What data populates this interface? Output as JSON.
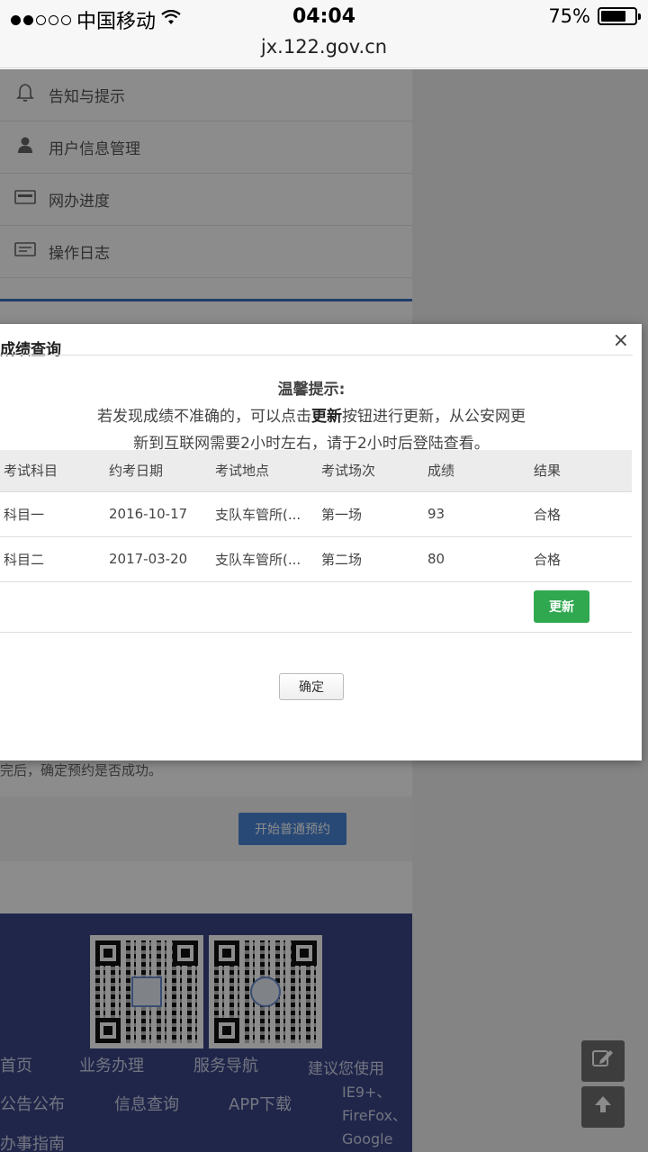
{
  "status_bar": {
    "carrier": "中国移动",
    "time": "04:04",
    "url": "jx.122.gov.cn",
    "battery": "75%",
    "battery_level": 0.75
  },
  "menu": {
    "items": [
      {
        "label": "告知与提示",
        "icon": "bell-icon"
      },
      {
        "label": "用户信息管理",
        "icon": "user-icon"
      },
      {
        "label": "网办进度",
        "icon": "progress-icon"
      },
      {
        "label": "操作日志",
        "icon": "log-icon"
      }
    ]
  },
  "background": {
    "appointment_button": "开始普通预约",
    "appointment_hint": "完后，确定预约是否成功。"
  },
  "footer": {
    "links_row1": [
      "首页",
      "业务办理",
      "服务导航"
    ],
    "links_row2": [
      "公告公布",
      "信息查询",
      "APP下载"
    ],
    "links_row3": [
      "办事指南"
    ],
    "browser_note_title": "建议您使用",
    "browser_note_lines": [
      "IE9+、",
      "FireFox、",
      "Google"
    ]
  },
  "modal": {
    "title": "成绩查询",
    "close": "×",
    "notice_title": "温馨提示:",
    "notice_line1_a": "若发现成绩不准确的，可以点击",
    "notice_line1_bold": "更新",
    "notice_line1_b": "按钮进行更新，从公安网更",
    "notice_line2": "新到互联网需要2小时左右，请于2小时后登陆查看。",
    "table": {
      "headers": [
        "考试科目",
        "约考日期",
        "考试地点",
        "考试场次",
        "成绩",
        "结果"
      ],
      "rows": [
        [
          "科目一",
          "2016-10-17",
          "支队车管所(...",
          "第一场",
          "93",
          "合格"
        ],
        [
          "科目二",
          "2017-03-20",
          "支队车管所(...",
          "第二场",
          "80",
          "合格"
        ]
      ]
    },
    "update_button": "更新",
    "confirm_button": "确定"
  }
}
